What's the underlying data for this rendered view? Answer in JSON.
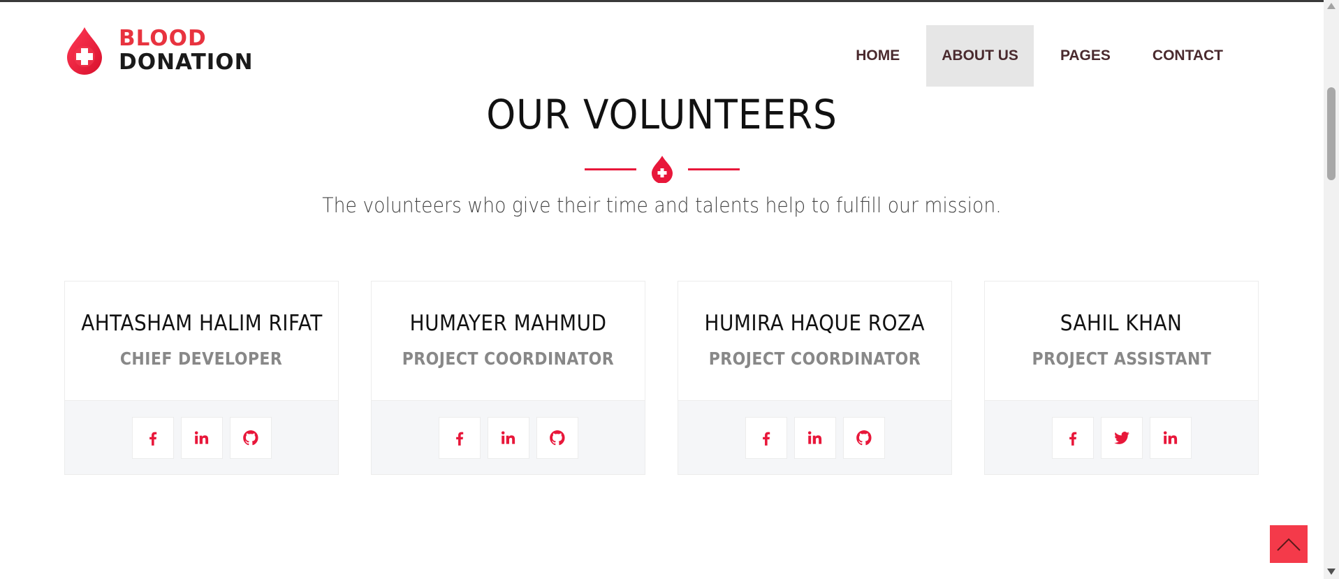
{
  "brand": {
    "line1": "BLOOD",
    "line2": "DONATION",
    "accent_color": "#e8333f"
  },
  "nav": {
    "items": [
      {
        "label": "HOME",
        "active": false
      },
      {
        "label": "ABOUT US",
        "active": true
      },
      {
        "label": "PAGES",
        "active": false
      },
      {
        "label": "CONTACT",
        "active": false
      }
    ]
  },
  "section": {
    "title": "OUR VOLUNTEERS",
    "subtitle": "The volunteers who give their time and talents help to fulfill our mission."
  },
  "volunteers": [
    {
      "name": "AHTASHAM HALIM RIFAT",
      "role": "CHIEF DEVELOPER",
      "socials": [
        "facebook-icon",
        "linkedin-icon",
        "github-icon"
      ]
    },
    {
      "name": "HUMAYER MAHMUD",
      "role": "PROJECT COORDINATOR",
      "socials": [
        "facebook-icon",
        "linkedin-icon",
        "github-icon"
      ]
    },
    {
      "name": "HUMIRA HAQUE ROZA",
      "role": "PROJECT COORDINATOR",
      "socials": [
        "facebook-icon",
        "linkedin-icon",
        "github-icon"
      ]
    },
    {
      "name": "SAHIL KHAN",
      "role": "PROJECT ASSISTANT",
      "socials": [
        "facebook-icon",
        "twitter-icon",
        "linkedin-icon"
      ]
    }
  ],
  "colors": {
    "icon_red": "#e8173a",
    "back_to_top": "#f43a4a"
  }
}
